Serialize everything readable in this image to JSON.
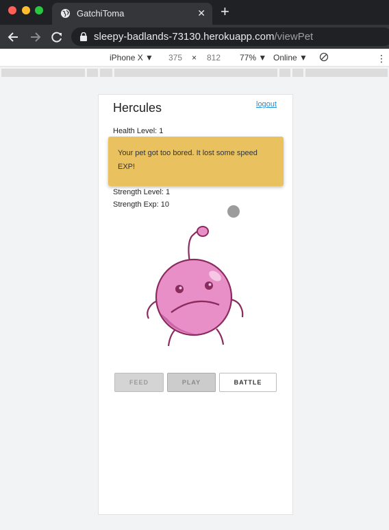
{
  "browser": {
    "tab_title": "GatchiToma",
    "tab_close": "✕",
    "new_tab": "+",
    "url_host": "sleepy-badlands-73130.herokuapp.com",
    "url_path": "/viewPet"
  },
  "devtools": {
    "device": "iPhone X ▼",
    "width": "375",
    "times": "×",
    "height": "812",
    "zoom": "77% ▼",
    "network": "Online ▼",
    "more": "⋮"
  },
  "page": {
    "pet_name": "Hercules",
    "logout": "logout",
    "stats": {
      "health_level": "Health Level: 1",
      "strength_level": "Strength Level: 1",
      "strength_exp": "Strength Exp: 10"
    },
    "toast": "Your pet got too bored. It lost some speed EXP!",
    "buttons": {
      "feed": "FEED",
      "play": "PLAY",
      "battle": "BATTLE"
    }
  },
  "colors": {
    "toast_bg": "#e9c15f",
    "pet_pink": "#e88fc8",
    "link": "#1a8fd6"
  }
}
